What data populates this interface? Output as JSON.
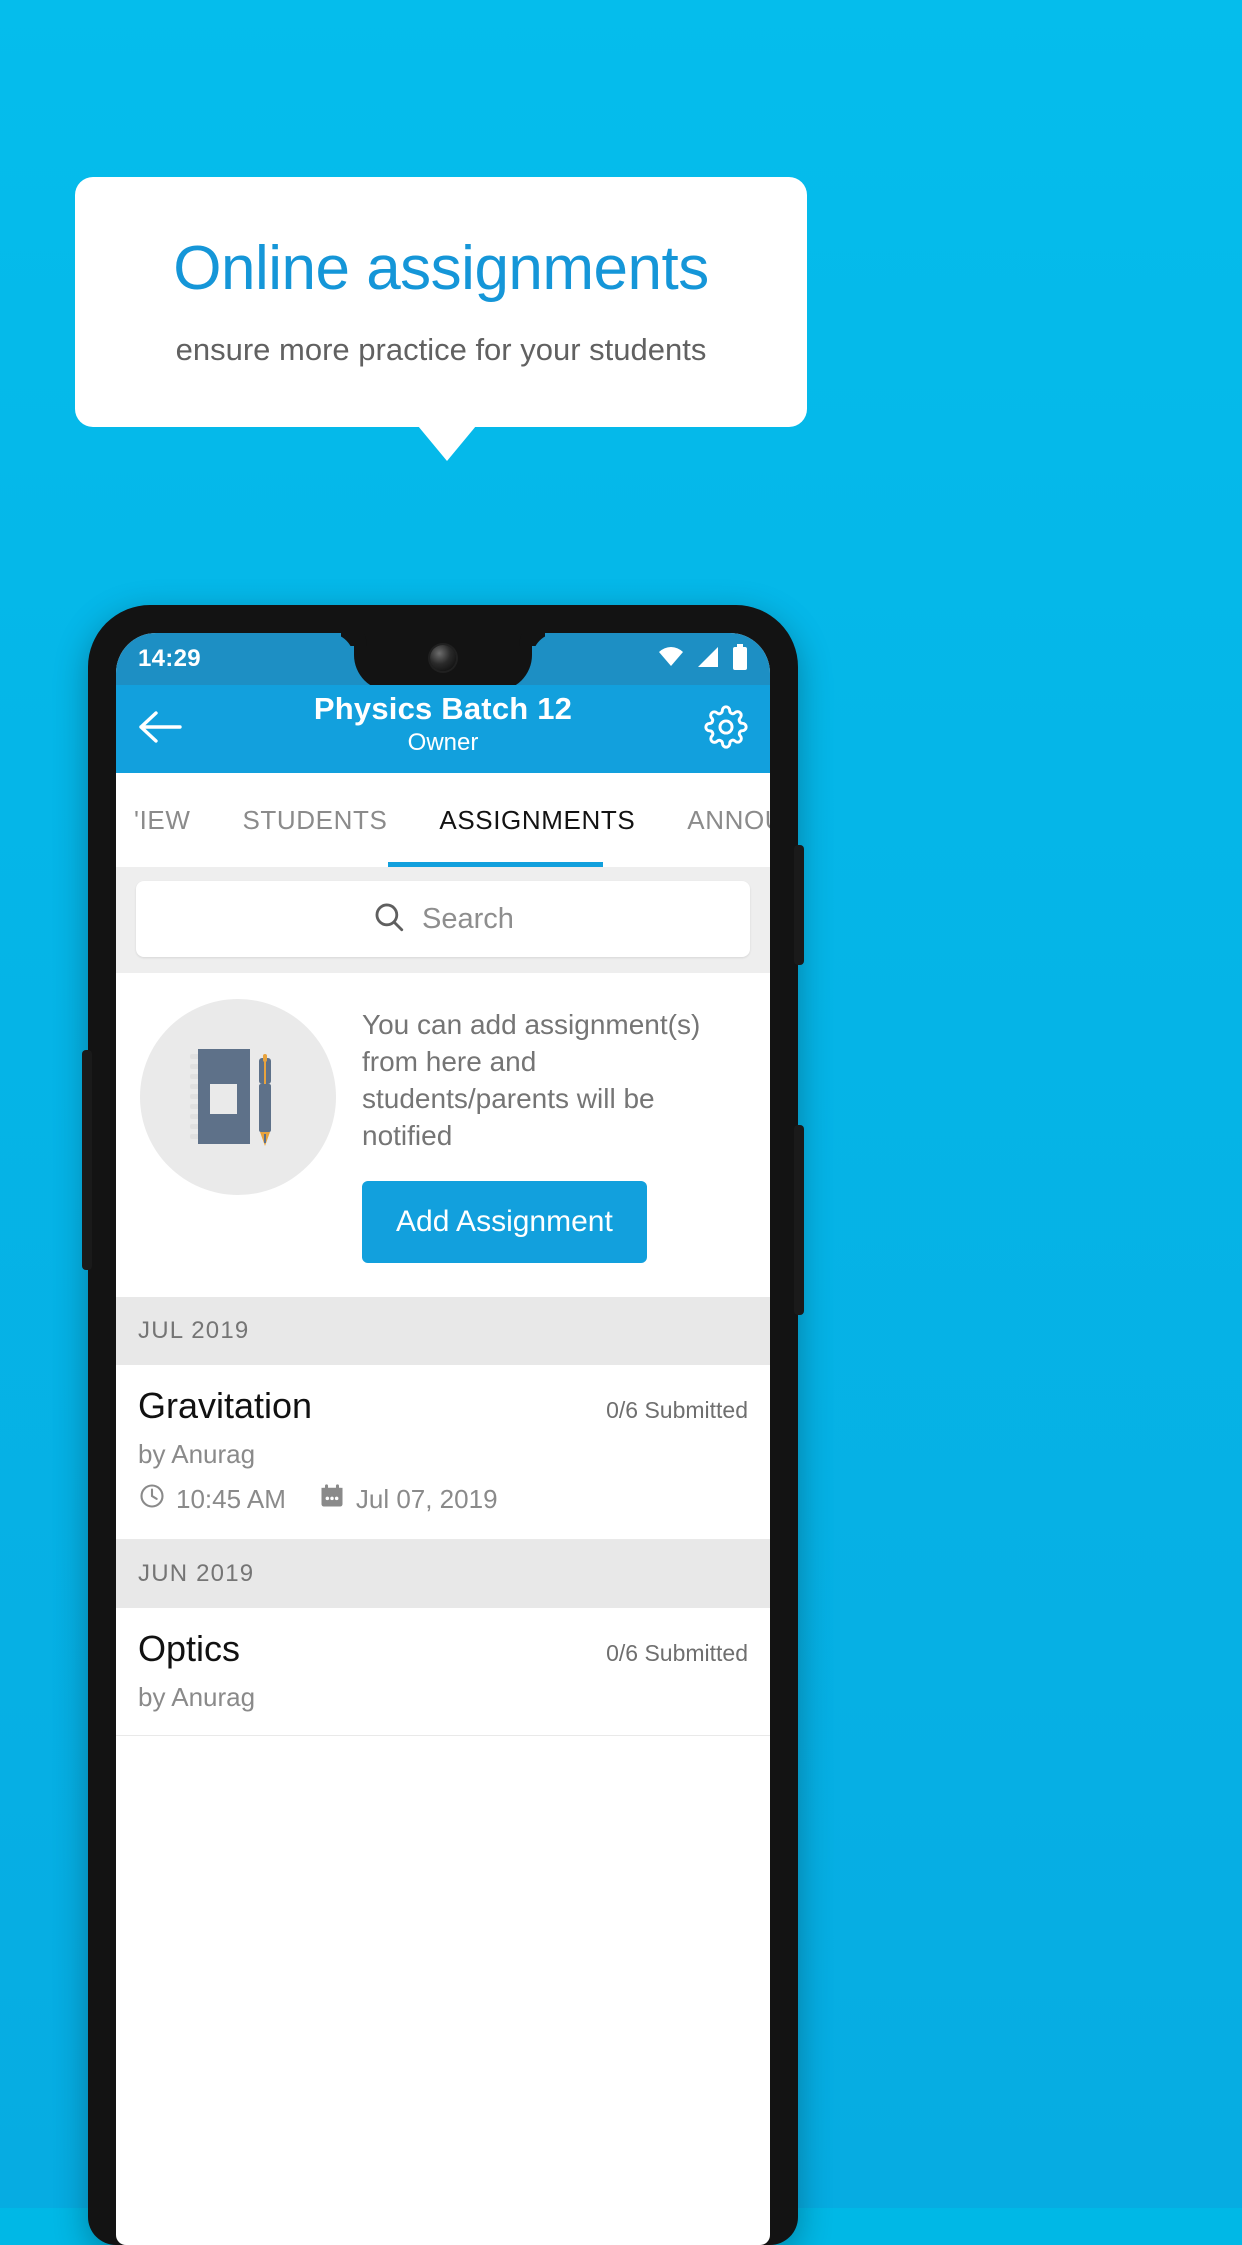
{
  "promo": {
    "title": "Online assignments",
    "subtitle": "ensure more practice for your students",
    "title_color": "#1596d8",
    "background_color": "#05b6e8"
  },
  "phone": {
    "status_bar": {
      "time": "14:29",
      "icons": [
        "wifi-icon",
        "signal-icon",
        "battery-icon"
      ]
    },
    "app_bar": {
      "back_icon": "back-arrow-icon",
      "title": "Physics Batch 12",
      "subtitle": "Owner",
      "settings_icon": "gear-icon",
      "background_color": "#12a0dd"
    },
    "tabs": {
      "items": [
        {
          "label": "'IEW",
          "active": false
        },
        {
          "label": "STUDENTS",
          "active": false
        },
        {
          "label": "ASSIGNMENTS",
          "active": true
        },
        {
          "label": "ANNOUNCEM",
          "active": false
        }
      ],
      "indicator_color": "#12a0dd"
    },
    "search": {
      "icon": "search-icon",
      "placeholder": "Search",
      "value": ""
    },
    "empty_state": {
      "illustration": "notebook-and-pen-icon",
      "message": "You can add assignment(s) from here and students/parents will be notified",
      "button_label": "Add Assignment",
      "button_color": "#12a0dd"
    },
    "assignment_groups": [
      {
        "month": "JUL 2019",
        "items": [
          {
            "title": "Gravitation",
            "submitted": "0/6 Submitted",
            "author": "by Anurag",
            "time_icon": "clock-icon",
            "time": "10:45 AM",
            "date_icon": "calendar-icon",
            "date": "Jul 07, 2019"
          }
        ]
      },
      {
        "month": "JUN 2019",
        "items": [
          {
            "title": "Optics",
            "submitted": "0/6 Submitted",
            "author": "by Anurag",
            "time_icon": "clock-icon",
            "time": "",
            "date_icon": "calendar-icon",
            "date": ""
          }
        ]
      }
    ]
  }
}
